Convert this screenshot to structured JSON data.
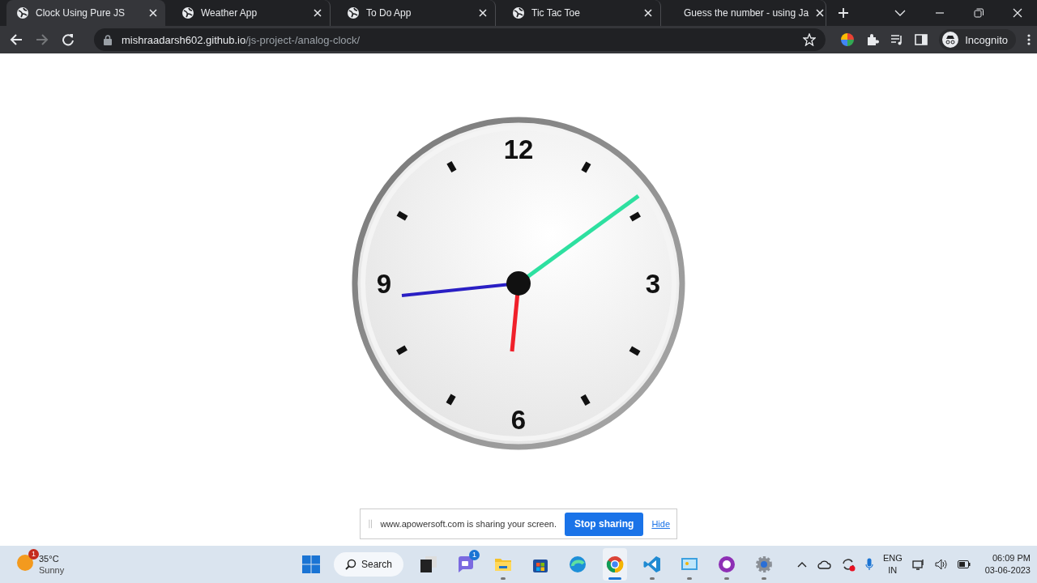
{
  "browser": {
    "tabs": [
      {
        "title": "Clock Using Pure JS",
        "selected": true
      },
      {
        "title": "Weather App",
        "selected": false
      },
      {
        "title": "To Do App",
        "selected": false
      },
      {
        "title": "Tic Tac Toe",
        "selected": false
      },
      {
        "title": "Guess the number - using Ja",
        "selected": false
      }
    ],
    "address": {
      "domain": "mishraadarsh602.github.io",
      "path": "/js-project-/analog-clock/"
    },
    "profile": "Incognito"
  },
  "clock": {
    "numerals": [
      "12",
      "3",
      "6",
      "9"
    ]
  },
  "share_bar": {
    "message": "www.apowersoft.com is sharing your screen.",
    "stop_button": "Stop sharing",
    "hide_link": "Hide"
  },
  "taskbar": {
    "weather": {
      "temperature": "35°C",
      "condition": "Sunny",
      "badge": "1"
    },
    "search": "Search",
    "apps": [
      {
        "kind": "task-view",
        "running": false,
        "selected": false
      },
      {
        "kind": "chat",
        "running": false,
        "selected": false,
        "badge": "1"
      },
      {
        "kind": "folder",
        "running": true,
        "selected": false
      },
      {
        "kind": "store",
        "running": false,
        "selected": false
      },
      {
        "kind": "edge",
        "running": false,
        "selected": false
      },
      {
        "kind": "chrome",
        "running": true,
        "selected": true
      },
      {
        "kind": "code",
        "running": true,
        "selected": false
      },
      {
        "kind": "screen",
        "running": true,
        "selected": false
      },
      {
        "kind": "github",
        "running": true,
        "selected": false
      },
      {
        "kind": "gear",
        "running": true,
        "selected": false
      }
    ],
    "tray": {
      "language": "ENG",
      "region": "IN",
      "time": "06:09 PM",
      "date": "03-06-2023"
    }
  }
}
